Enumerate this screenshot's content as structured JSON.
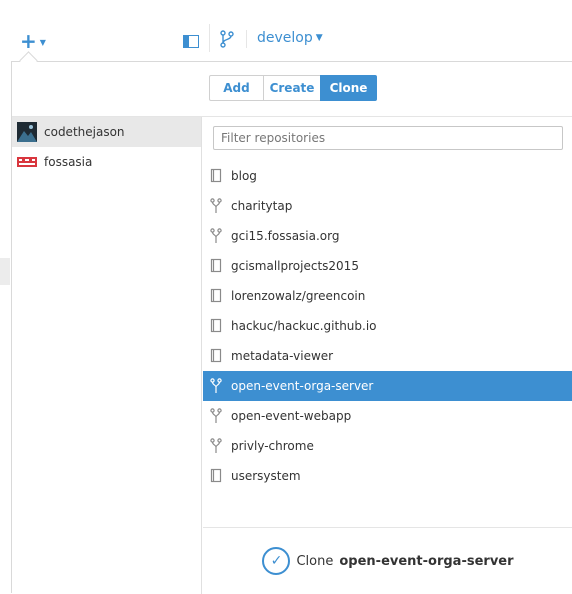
{
  "toolbar": {
    "branch_name": "develop"
  },
  "tabs": [
    {
      "label": "Add"
    },
    {
      "label": "Create"
    },
    {
      "label": "Clone"
    }
  ],
  "accounts": [
    {
      "name": "codethejason",
      "selected": true
    },
    {
      "name": "fossasia",
      "selected": false
    }
  ],
  "filter": {
    "placeholder": "Filter repositories",
    "value": ""
  },
  "repos": [
    {
      "name": "blog",
      "icon": "repo-icon"
    },
    {
      "name": "charitytap",
      "icon": "fork-icon"
    },
    {
      "name": "gci15.fossasia.org",
      "icon": "fork-icon"
    },
    {
      "name": "gcismallprojects2015",
      "icon": "repo-icon"
    },
    {
      "name": "lorenzowalz/greencoin",
      "icon": "repo-icon"
    },
    {
      "name": "hackuc/hackuc.github.io",
      "icon": "repo-icon"
    },
    {
      "name": "metadata-viewer",
      "icon": "repo-icon"
    },
    {
      "name": "open-event-orga-server",
      "icon": "fork-icon",
      "selected": true
    },
    {
      "name": "open-event-webapp",
      "icon": "fork-icon"
    },
    {
      "name": "privly-chrome",
      "icon": "fork-icon"
    },
    {
      "name": "usersystem",
      "icon": "repo-icon"
    }
  ],
  "footer": {
    "clone_prefix": "Clone",
    "clone_target": "open-event-orga-server"
  },
  "colors": {
    "accent": "#3d8fd1",
    "selected_row": "#3d8fd1",
    "selected_account": "#e8e8e8"
  }
}
